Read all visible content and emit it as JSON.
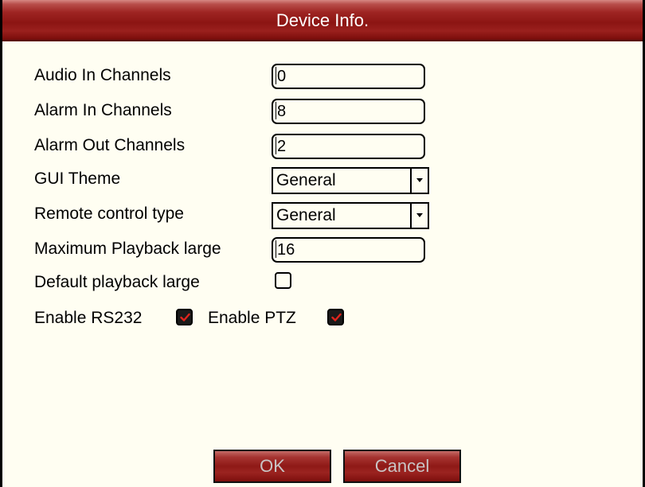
{
  "dialog": {
    "title": "Device Info."
  },
  "fields": {
    "audio_in": {
      "label": "Audio In Channels",
      "value": "0"
    },
    "alarm_in": {
      "label": "Alarm In Channels",
      "value": "8"
    },
    "alarm_out": {
      "label": "Alarm Out Channels",
      "value": "2"
    },
    "max_playback": {
      "label": "Maximum Playback large",
      "value": "16"
    }
  },
  "selects": {
    "gui_theme": {
      "label": "GUI Theme",
      "value": "General"
    },
    "remote_type": {
      "label": "Remote control type",
      "value": "General"
    }
  },
  "checkboxes": {
    "default_playback": {
      "label": "Default playback large",
      "checked": false
    },
    "rs232": {
      "label": "Enable RS232",
      "checked": true
    },
    "ptz": {
      "label": "Enable PTZ",
      "checked": true
    }
  },
  "buttons": {
    "ok": "OK",
    "cancel": "Cancel"
  },
  "colors": {
    "title_bar": "#8c1513",
    "panel_background": "#fffef2",
    "check_mark": "#e0241d",
    "button_text": "#c9c4c4"
  },
  "icons": {
    "select_arrow": "chevron-down-icon",
    "check_mark": "check-icon"
  }
}
